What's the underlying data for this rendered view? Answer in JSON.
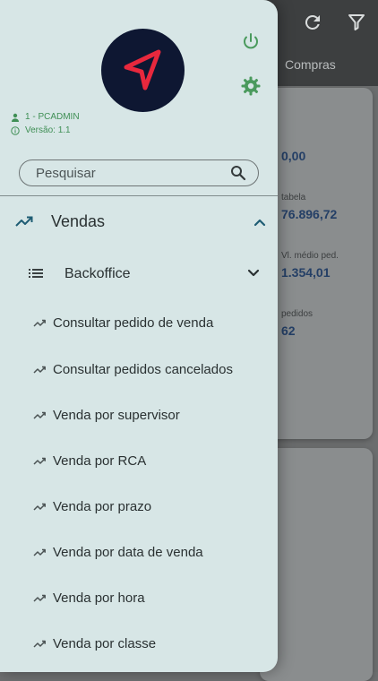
{
  "background": {
    "tab_label": "Compras",
    "card": {
      "items": [
        {
          "label": "",
          "value": "0,00"
        },
        {
          "label": "tabela",
          "value": "76.896,72"
        },
        {
          "label": "Vl. médio ped.",
          "value": "1.354,01"
        },
        {
          "label": "pedidos",
          "value": "62"
        }
      ]
    }
  },
  "drawer": {
    "user": "1 - PCADMIN",
    "version": "Versão: 1.1",
    "search": {
      "placeholder": "Pesquisar"
    },
    "section": {
      "label": "Vendas"
    },
    "subsection": {
      "label": "Backoffice"
    },
    "items": [
      {
        "label": "Consultar pedido de venda"
      },
      {
        "label": "Consultar pedidos cancelados"
      },
      {
        "label": "Venda por supervisor"
      },
      {
        "label": "Venda por RCA"
      },
      {
        "label": "Venda por prazo"
      },
      {
        "label": "Venda por data de venda"
      },
      {
        "label": "Venda por hora"
      },
      {
        "label": "Venda por classe"
      }
    ]
  },
  "colors": {
    "drawer_bg": "#d7e6e6",
    "accent_green": "#3f8f55",
    "accent_teal": "#1f5d74",
    "logo_bg": "#0e1732",
    "logo_arrow": "#e8283d"
  }
}
